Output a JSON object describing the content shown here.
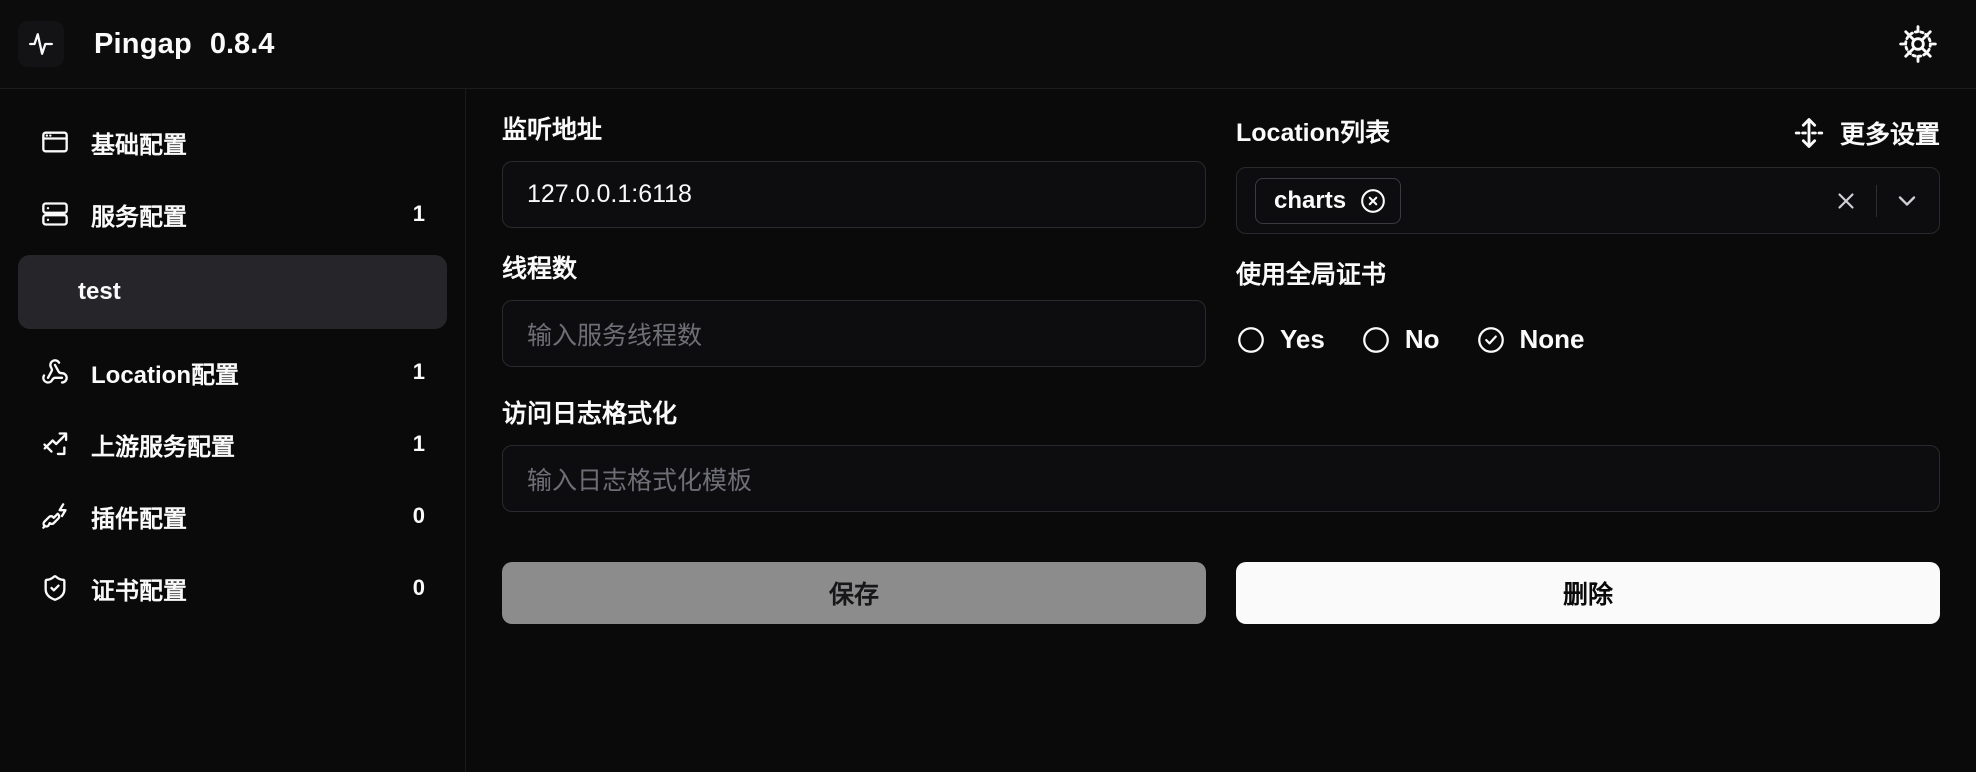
{
  "header": {
    "logo_icon": "activity-pulse-icon",
    "title": "Pingap",
    "version": "0.8.4",
    "settings_icon": "gear-icon"
  },
  "sidebar": {
    "items": [
      {
        "id": "basic",
        "icon": "app-window-icon",
        "label": "基础配置",
        "count": ""
      },
      {
        "id": "server",
        "icon": "server-icon",
        "label": "服务配置",
        "count": "1"
      },
      {
        "id": "location",
        "icon": "webhook-icon",
        "label": "Location配置",
        "count": "1"
      },
      {
        "id": "upstream",
        "icon": "network-chart-icon",
        "label": "上游服务配置",
        "count": "1"
      },
      {
        "id": "plugin",
        "icon": "plug-zap-icon",
        "label": "插件配置",
        "count": "0"
      },
      {
        "id": "certificate",
        "icon": "shield-check-icon",
        "label": "证书配置",
        "count": "0"
      }
    ],
    "sub_item": {
      "label": "test",
      "parent": "服务配置",
      "selected": true
    }
  },
  "main": {
    "addr": {
      "label": "监听地址",
      "value": "127.0.0.1:6118",
      "placeholder": ""
    },
    "threads": {
      "label": "线程数",
      "value": "",
      "placeholder": "输入服务线程数"
    },
    "access_log": {
      "label": "访问日志格式化",
      "value": "",
      "placeholder": "输入日志格式化模板"
    },
    "locations": {
      "label": "Location列表",
      "tags": [
        "charts"
      ],
      "clear_icon": "close-x-icon",
      "chevron_icon": "chevron-down-icon",
      "tag_remove_icon": "circle-x-icon"
    },
    "more_settings": {
      "label": "更多设置",
      "icon": "expand-vertical-icon"
    },
    "global_cert": {
      "label": "使用全局证书",
      "options": [
        {
          "value": "yes",
          "label": "Yes",
          "selected": false
        },
        {
          "value": "no",
          "label": "No",
          "selected": false
        },
        {
          "value": "none",
          "label": "None",
          "selected": true
        }
      ]
    },
    "buttons": {
      "save": "保存",
      "delete": "删除"
    }
  },
  "colors": {
    "background": "#0a0a0a",
    "panel": "#0d0d0f",
    "border": "#2a2a2e",
    "selected_bg": "#26262a",
    "text": "#fafafa",
    "muted": "#6e6e76",
    "save_bg": "#8c8c8c",
    "delete_bg": "#fafafa"
  }
}
